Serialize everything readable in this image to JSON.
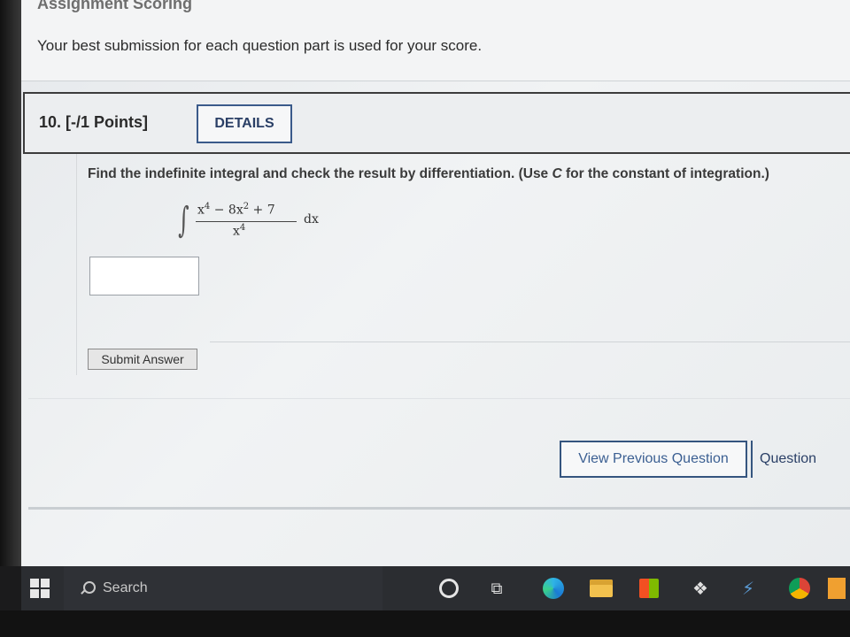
{
  "page": {
    "assignment_heading": "Assignment Scoring",
    "best_submission_text": "Your best submission for each question part is used for your score."
  },
  "question": {
    "number_label": "10.  [-/1 Points]",
    "details_label": "DETAILS",
    "prompt_prefix": "Find the indefinite integral and check the result by differentiation. (Use ",
    "prompt_var": "C",
    "prompt_suffix": " for the constant of integration.)",
    "integrand": {
      "numerator_parts": [
        "x",
        "4",
        " − 8x",
        "2",
        " + 7"
      ],
      "denominator_base": "x",
      "denominator_exp": "4",
      "differential": "dx"
    },
    "answer_value": "",
    "submit_label": "Submit Answer"
  },
  "navigation": {
    "view_previous_label": "View Previous Question",
    "next_label": "Question"
  },
  "taskbar": {
    "search_placeholder": "Search",
    "icons": [
      "windows-start-icon",
      "search-icon",
      "cortana-icon",
      "task-view-icon",
      "edge-icon",
      "file-explorer-icon",
      "store-icon",
      "dropbox-icon",
      "lightning-icon",
      "chrome-icon",
      "app-icon"
    ]
  }
}
